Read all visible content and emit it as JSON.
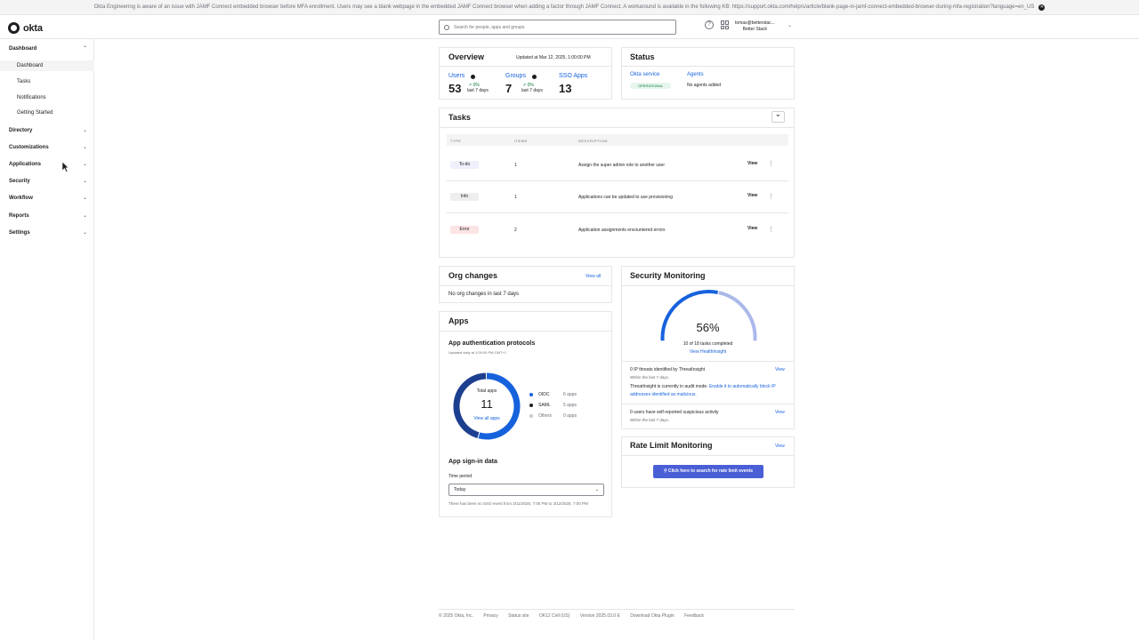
{
  "banner": {
    "text": "Okta Engineering is aware of an issue with JAMF Connect embedded browser before MFA enrollment. Users may see a blank webpage in the embedded JAMF Connect browser when adding a factor through JAMF Connect. A workaround is available in the following KB: https://support.okta.com/help/s/article/blank-page-in-jamf-connect-embedded-browser-during-mfa-registration?language=en_US",
    "close": "✕"
  },
  "header": {
    "logo_text": "okta",
    "search_placeholder": "Search for people, apps and groups",
    "help": "?",
    "user_email": "tomas@betterstac...",
    "user_org": "Better Stack"
  },
  "sidebar": {
    "groups": [
      {
        "label": "Dashboard",
        "chev": "⌃"
      },
      {
        "label": "Directory",
        "chev": "⌄"
      },
      {
        "label": "Customizations",
        "chev": "⌄"
      },
      {
        "label": "Applications",
        "chev": "⌄"
      },
      {
        "label": "Security",
        "chev": "⌄"
      },
      {
        "label": "Workflow",
        "chev": "⌄"
      },
      {
        "label": "Reports",
        "chev": "⌄"
      },
      {
        "label": "Settings",
        "chev": "⌄"
      }
    ],
    "items": [
      "Dashboard",
      "Tasks",
      "Notifications",
      "Getting Started"
    ]
  },
  "overview": {
    "title": "Overview",
    "updated": "Updated at Mar 12, 2025, 1:00:00 PM",
    "users": {
      "label": "Users",
      "value": "53",
      "delta": "↗ 0%",
      "period": "last 7 days"
    },
    "groups": {
      "label": "Groups",
      "value": "7",
      "delta": "↗ 0%",
      "period": "last 7 days"
    },
    "sso": {
      "label": "SSO Apps",
      "value": "13"
    }
  },
  "status": {
    "title": "Status",
    "okta_service": "Okta service",
    "operational": "OPERATIONAL",
    "agents": "Agents",
    "agents_value": "No agents added"
  },
  "tasks": {
    "title": "Tasks",
    "columns": [
      "TYPE",
      "ITEMS",
      "DESCRIPTION"
    ],
    "rows": [
      {
        "type": "To-do",
        "items": "1",
        "description": "Assign the super admin role to another user",
        "action": "View"
      },
      {
        "type": "Info",
        "items": "1",
        "description": "Applications can be updated to use provisioning",
        "action": "View"
      },
      {
        "type": "Error",
        "items": "2",
        "description": "Application assignments encountered errors",
        "action": "View"
      }
    ],
    "kebab": "⋮"
  },
  "org_changes": {
    "title": "Org changes",
    "view_all": "View all",
    "body": "No org changes in last 7 days"
  },
  "apps": {
    "title": "Apps",
    "subtitle": "App authentication protocols",
    "updated": "Updated daily at 1:00:00 PM GMT+1",
    "donut_label": "Total apps",
    "donut_value": "11",
    "donut_link": "View all apps",
    "legend": [
      {
        "name": "OIDC",
        "count": "6 apps",
        "color": "#1662dd",
        "value": 6
      },
      {
        "name": "SAML",
        "count": "5 apps",
        "color": "#1d1d21",
        "value": 5
      },
      {
        "name": "Others",
        "count": "0 apps",
        "color": "#c8c8d0",
        "value": 0
      }
    ],
    "signin_title": "App sign-in data",
    "time_period_label": "Time period",
    "time_period_value": "Today",
    "no_sso": "There has been no SSO event from 3/11/2025, 7:00 PM to 3/12/2025, 7:00 PM"
  },
  "security_monitoring": {
    "title": "Security Monitoring",
    "percent_text": "56%",
    "percent": 56,
    "tasks_completed": "10 of 18 tasks completed",
    "link": "View HealthInsight",
    "threats_line": "0 IP threats identified by ThreatInsight",
    "threats_period": "Within the last 7 days.",
    "audit_prefix": "ThreatInsight is currently in audit mode.",
    "audit_link": "Enable it to automatically block IP addresses identified as malicious.",
    "view1": "View",
    "suspicious_line": "0 users have self-reported suspicious activity",
    "suspicious_period": "Within the last 7 days.",
    "view2": "View"
  },
  "rate_limit": {
    "title": "Rate Limit Monitoring",
    "view": "View",
    "button": "Click here to search for rate limit events"
  },
  "footer": {
    "items": [
      "© 2025 Okta, Inc.",
      "Privacy",
      "Status site",
      "OK12 Cell (US)",
      "Version 2025.03.0 E",
      "Download Okta Plugin",
      "Feedback"
    ]
  },
  "colors": {
    "accent": "#1662dd",
    "success_bg": "#e6f6ec",
    "error_bg": "#fde4e4",
    "info_bg": "#eeeeef",
    "todo_bg": "#eef1fb",
    "button": "#4a5fd6"
  }
}
